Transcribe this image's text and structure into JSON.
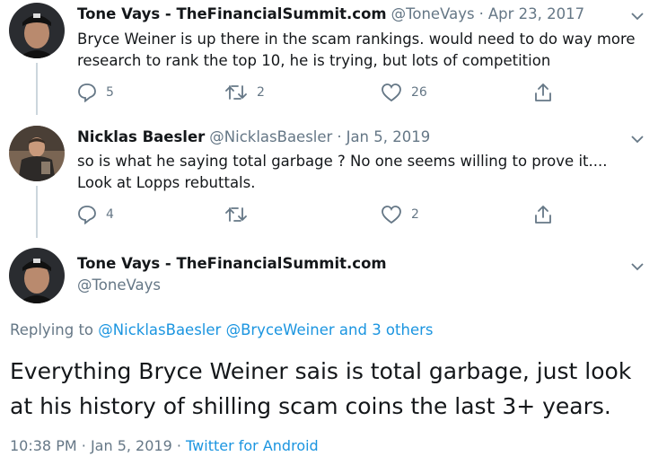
{
  "tweets": [
    {
      "name": "Tone Vays - TheFinancialSummit.com",
      "handle": "@ToneVays",
      "sep": "·",
      "date": "Apr 23, 2017",
      "text_line1": "Bryce Weiner is up there in the scam rankings. would need to do way more",
      "text_line2": "research to rank the top 10, he is trying, but lots of competition",
      "replies": "5",
      "retweets": "2",
      "likes": "26"
    },
    {
      "name": "Nicklas Baesler",
      "handle": "@NicklasBaesler",
      "sep": "·",
      "date": "Jan 5, 2019",
      "text_line1": "so is what he saying total garbage ?  No one seems willing to prove it....",
      "text_line2": "Look at Lopps rebuttals.",
      "replies": "4",
      "retweets": "",
      "likes": "2"
    }
  ],
  "focused": {
    "name": "Tone Vays - TheFinancialSummit.com",
    "handle": "@ToneVays",
    "replying_prefix": "Replying to",
    "replying_user1": "@NicklasBaesler",
    "replying_user2": "@BryceWeiner",
    "replying_others": "and 3 others",
    "text_line1": "Everything Bryce Weiner sais is total garbage, just look",
    "text_line2": "at his history of shilling scam coins the last 3+ years.",
    "time": "10:38 PM",
    "sep1": "·",
    "date": "Jan 5, 2019",
    "sep2": "·",
    "source": "Twitter for Android"
  },
  "icons": [
    "avatar",
    "chevron-down-icon",
    "reply-icon",
    "retweet-icon",
    "like-icon",
    "share-icon"
  ],
  "colors": {
    "link": "#1b95e0",
    "muted": "#657786",
    "text": "#14171a",
    "thread": "#ccd6dd"
  }
}
